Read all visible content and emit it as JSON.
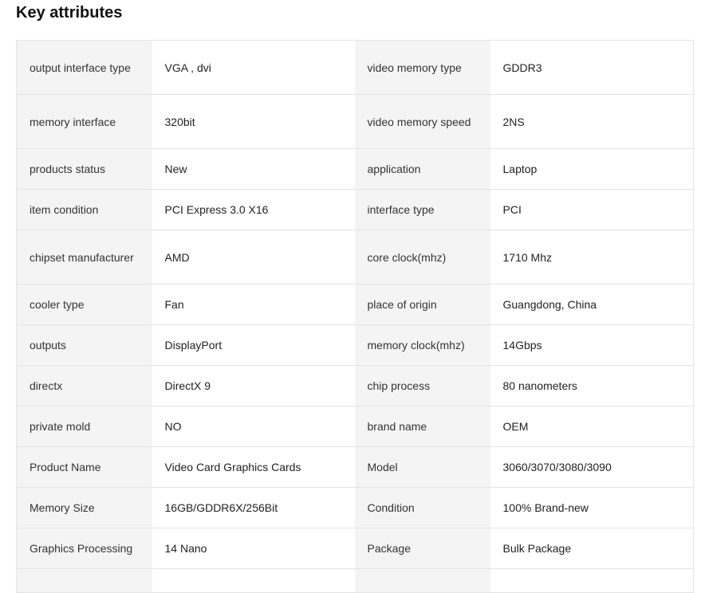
{
  "section": {
    "title": "Key attributes"
  },
  "rows": [
    {
      "k1": "output interface type",
      "v1": "VGA , dvi",
      "k2": "video memory type",
      "v2": "GDDR3"
    },
    {
      "k1": "memory interface",
      "v1": "320bit",
      "k2": "video memory speed",
      "v2": "2NS"
    },
    {
      "k1": "products status",
      "v1": "New",
      "k2": "application",
      "v2": "Laptop"
    },
    {
      "k1": "item condition",
      "v1": "PCI Express 3.0 X16",
      "k2": "interface type",
      "v2": "PCI"
    },
    {
      "k1": "chipset manufacturer",
      "v1": "AMD",
      "k2": "core clock(mhz)",
      "v2": "1710 Mhz"
    },
    {
      "k1": "cooler type",
      "v1": "Fan",
      "k2": "place of origin",
      "v2": "Guangdong, China"
    },
    {
      "k1": "outputs",
      "v1": "DisplayPort",
      "k2": "memory clock(mhz)",
      "v2": "14Gbps"
    },
    {
      "k1": "directx",
      "v1": "DirectX 9",
      "k2": "chip process",
      "v2": "80 nanometers"
    },
    {
      "k1": "private mold",
      "v1": "NO",
      "k2": "brand name",
      "v2": "OEM"
    },
    {
      "k1": "Product Name",
      "v1": "Video Card Graphics Cards",
      "k2": "Model",
      "v2": "3060/3070/3080/3090"
    },
    {
      "k1": "Memory Size",
      "v1": "16GB/GDDR6X/256Bit",
      "k2": "Condition",
      "v2": "100% Brand-new"
    },
    {
      "k1": "Graphics Processing",
      "v1": "14 Nano",
      "k2": "Package",
      "v2": "Bulk Package"
    }
  ]
}
